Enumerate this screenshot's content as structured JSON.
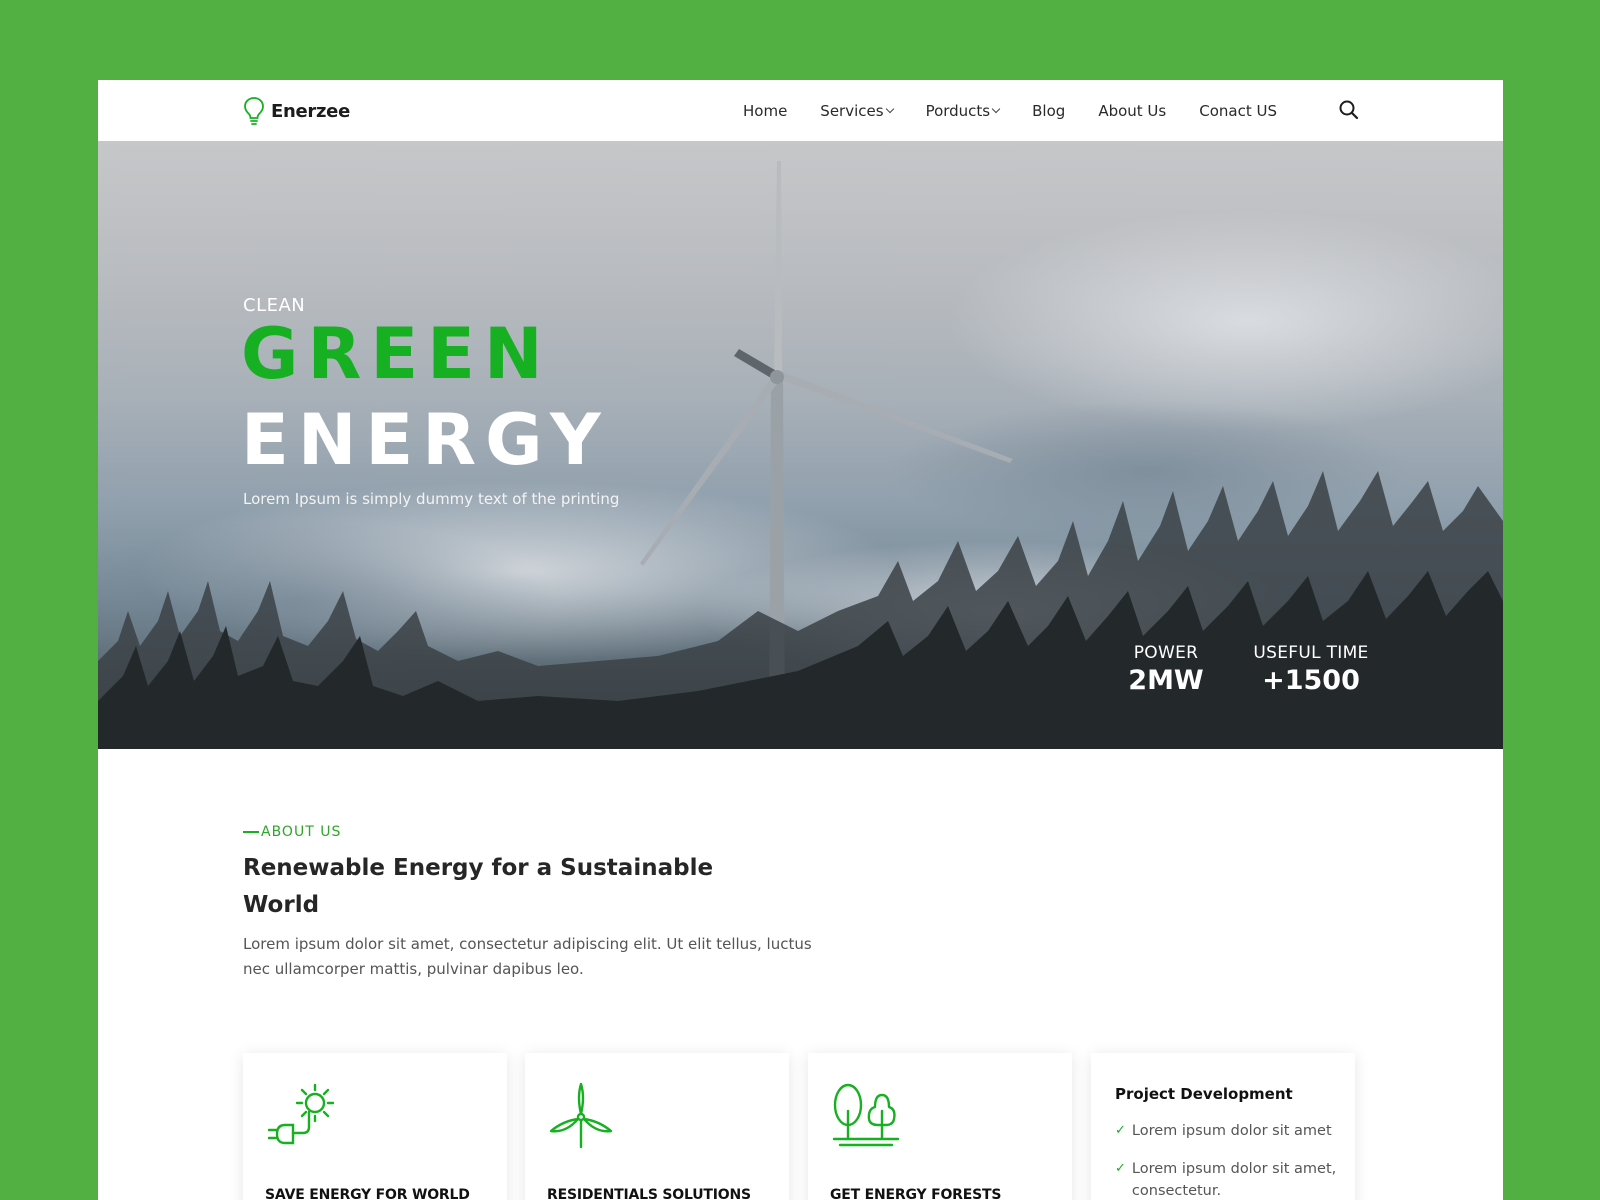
{
  "brand": {
    "name": "Enerzee",
    "accent": "#17b022",
    "background": "#52b043"
  },
  "nav": {
    "items": [
      {
        "label": "Home",
        "has_dropdown": false
      },
      {
        "label": "Services",
        "has_dropdown": true
      },
      {
        "label": "Porducts",
        "has_dropdown": true
      },
      {
        "label": "Blog",
        "has_dropdown": false
      },
      {
        "label": "About Us",
        "has_dropdown": false
      },
      {
        "label": "Conact US",
        "has_dropdown": false
      }
    ],
    "search_icon": "search-icon"
  },
  "hero": {
    "subtitle": "CLEAN",
    "title_line1": "GREEN",
    "title_line2": "ENERGY",
    "description": "Lorem Ipsum is simply dummy text of the printing",
    "stats": [
      {
        "label": "POWER",
        "value": "2MW"
      },
      {
        "label": "USEFUL TIME",
        "value": "+1500"
      }
    ]
  },
  "about": {
    "tag": "ABOUT US",
    "title": "Renewable Energy for a Sustainable World",
    "description": "Lorem ipsum dolor sit amet, consectetur adipiscing elit. Ut elit tellus, luctus nec ullamcorper mattis, pulvinar dapibus leo."
  },
  "cards": [
    {
      "title": "SAVE ENERGY FOR WORLD",
      "icon": "solar-plug-icon"
    },
    {
      "title": "RESIDENTIALS SOLUTIONS",
      "icon": "wind-turbine-icon"
    },
    {
      "title": "GET ENERGY FORESTS",
      "icon": "trees-icon"
    }
  ],
  "project": {
    "title": "Project Development",
    "items": [
      "Lorem ipsum dolor sit amet",
      "Lorem ipsum dolor sit amet, consectetur."
    ]
  }
}
